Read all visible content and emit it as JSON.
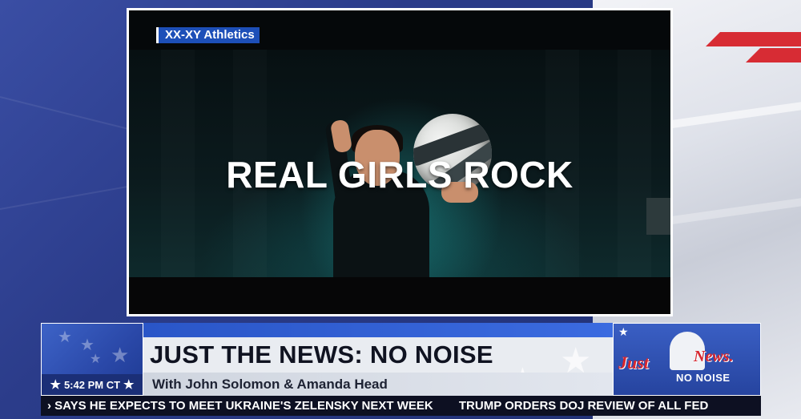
{
  "video": {
    "source_tag": "XX-XY Athletics",
    "headline": "REAL GIRLS ROCK"
  },
  "lower_third": {
    "clock": "5:42 PM CT",
    "title": "JUST THE NEWS: NO NOISE",
    "subtitle": "With John Solomon & Amanda Head",
    "logo": {
      "word1": "Just",
      "word2": "News.",
      "word3": "NO NOISE"
    }
  },
  "ticker": {
    "items": [
      "SAYS HE EXPECTS TO MEET UKRAINE'S ZELENSKY NEXT WEEK",
      "TRUMP ORDERS DOJ REVIEW OF ALL FED"
    ]
  },
  "colors": {
    "brand_blue": "#2a56c8",
    "accent_red": "#d72c34",
    "ticker_bg": "#0d1022"
  },
  "icons": {
    "star": "star-icon",
    "ticker_arrow": "chevron-right-icon"
  }
}
